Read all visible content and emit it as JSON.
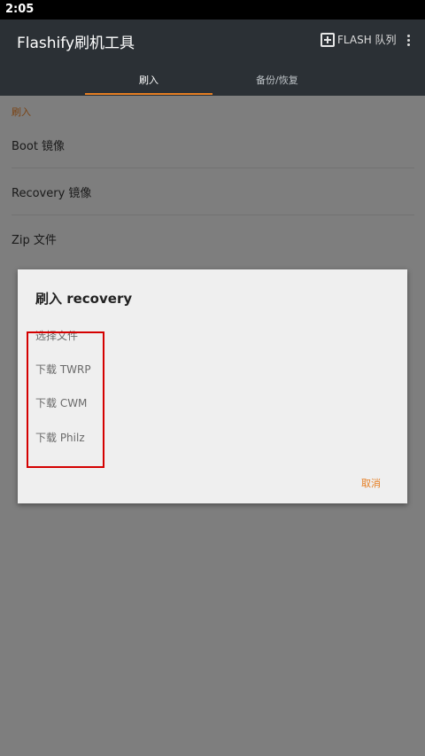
{
  "status_bar": {
    "time": "2:05"
  },
  "app_bar": {
    "title": "Flashify刷机工具",
    "flash_queue_label": "FLASH 队列",
    "add_icon": "library-add-icon",
    "more_icon": "more-vert-icon"
  },
  "tabs": [
    {
      "label": "刷入",
      "active": true
    },
    {
      "label": "备份/恢复",
      "active": false
    }
  ],
  "main": {
    "section_header": "刷入",
    "items": [
      {
        "label": "Boot 镜像"
      },
      {
        "label": "Recovery 镜像"
      },
      {
        "label": "Zip 文件"
      }
    ]
  },
  "dialog": {
    "title": "刷入 recovery",
    "options": [
      {
        "label": "选择文件"
      },
      {
        "label": "下载 TWRP"
      },
      {
        "label": "下载 CWM"
      },
      {
        "label": "下载 Philz"
      }
    ],
    "cancel_label": "取消"
  },
  "colors": {
    "accent": "#e67e22",
    "app_bar": "#2b3035",
    "annotation_box": "#d40000"
  }
}
